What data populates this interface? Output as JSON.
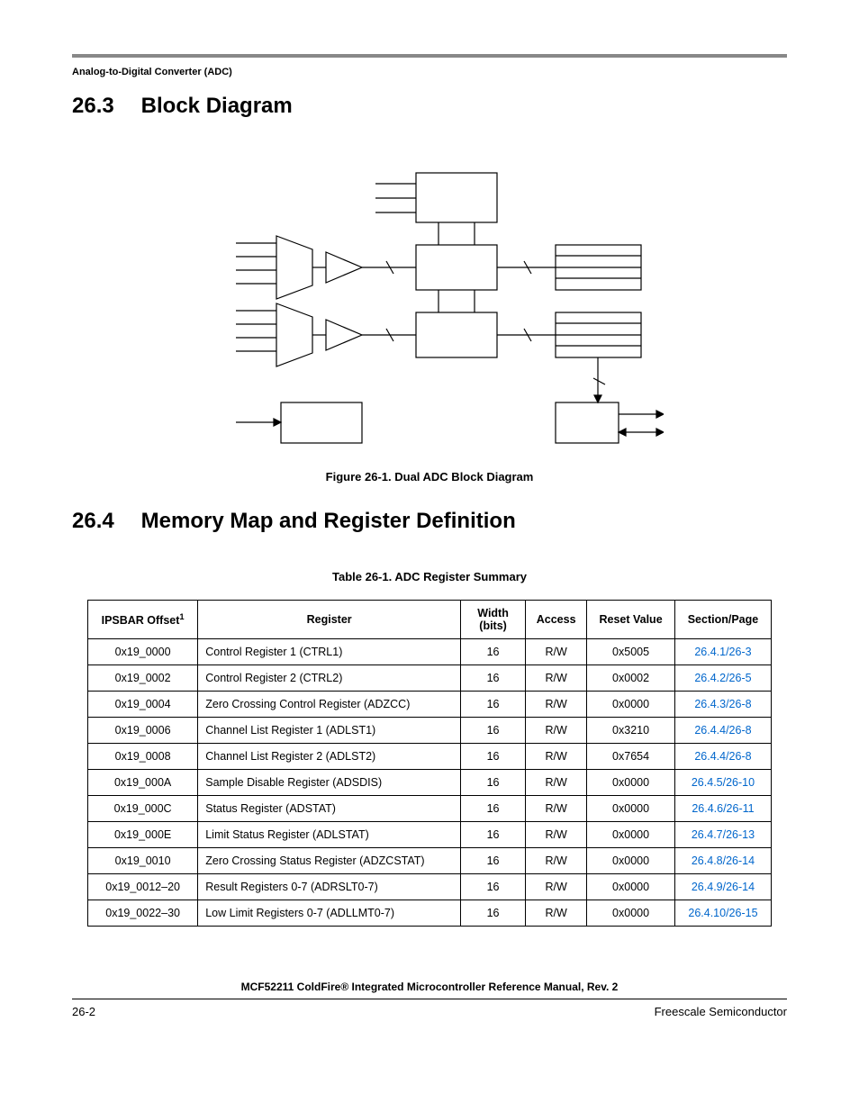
{
  "running_header": "Analog-to-Digital Converter (ADC)",
  "sections": {
    "s1_num": "26.3",
    "s1_title": "Block Diagram",
    "s2_num": "26.4",
    "s2_title": "Memory Map and Register Definition"
  },
  "figure_caption": "Figure 26-1. Dual ADC Block Diagram",
  "table_caption": "Table 26-1. ADC Register Summary",
  "table": {
    "headers": {
      "c0": "IPSBAR Offset",
      "c0_sup": "1",
      "c1": "Register",
      "c2": "Width (bits)",
      "c3": "Access",
      "c4": "Reset Value",
      "c5": "Section/Page"
    },
    "rows": [
      {
        "offset": "0x19_0000",
        "reg": "Control Register 1 (CTRL1)",
        "width": "16",
        "access": "R/W",
        "reset": "0x5005",
        "sp": "26.4.1/26-3"
      },
      {
        "offset": "0x19_0002",
        "reg": "Control Register 2 (CTRL2)",
        "width": "16",
        "access": "R/W",
        "reset": "0x0002",
        "sp": "26.4.2/26-5"
      },
      {
        "offset": "0x19_0004",
        "reg": "Zero Crossing Control Register (ADZCC)",
        "width": "16",
        "access": "R/W",
        "reset": "0x0000",
        "sp": "26.4.3/26-8"
      },
      {
        "offset": "0x19_0006",
        "reg": "Channel List Register 1 (ADLST1)",
        "width": "16",
        "access": "R/W",
        "reset": "0x3210",
        "sp": "26.4.4/26-8"
      },
      {
        "offset": "0x19_0008",
        "reg": "Channel List Register 2 (ADLST2)",
        "width": "16",
        "access": "R/W",
        "reset": "0x7654",
        "sp": "26.4.4/26-8"
      },
      {
        "offset": "0x19_000A",
        "reg": "Sample Disable Register (ADSDIS)",
        "width": "16",
        "access": "R/W",
        "reset": "0x0000",
        "sp": "26.4.5/26-10"
      },
      {
        "offset": "0x19_000C",
        "reg": "Status Register (ADSTAT)",
        "width": "16",
        "access": "R/W",
        "reset": "0x0000",
        "sp": "26.4.6/26-11"
      },
      {
        "offset": "0x19_000E",
        "reg": "Limit Status Register (ADLSTAT)",
        "width": "16",
        "access": "R/W",
        "reset": "0x0000",
        "sp": "26.4.7/26-13"
      },
      {
        "offset": "0x19_0010",
        "reg": "Zero Crossing Status Register (ADZCSTAT)",
        "width": "16",
        "access": "R/W",
        "reset": "0x0000",
        "sp": "26.4.8/26-14"
      },
      {
        "offset": "0x19_0012–20",
        "reg": "Result Registers 0-7 (ADRSLT0-7)",
        "width": "16",
        "access": "R/W",
        "reset": "0x0000",
        "sp": "26.4.9/26-14"
      },
      {
        "offset": "0x19_0022–30",
        "reg": "Low Limit Registers 0-7 (ADLLMT0-7)",
        "width": "16",
        "access": "R/W",
        "reset": "0x0000",
        "sp": "26.4.10/26-15"
      }
    ]
  },
  "footer": {
    "doc": "MCF52211 ColdFire® Integrated Microcontroller Reference Manual, Rev. 2",
    "page": "26-2",
    "company": "Freescale Semiconductor"
  }
}
